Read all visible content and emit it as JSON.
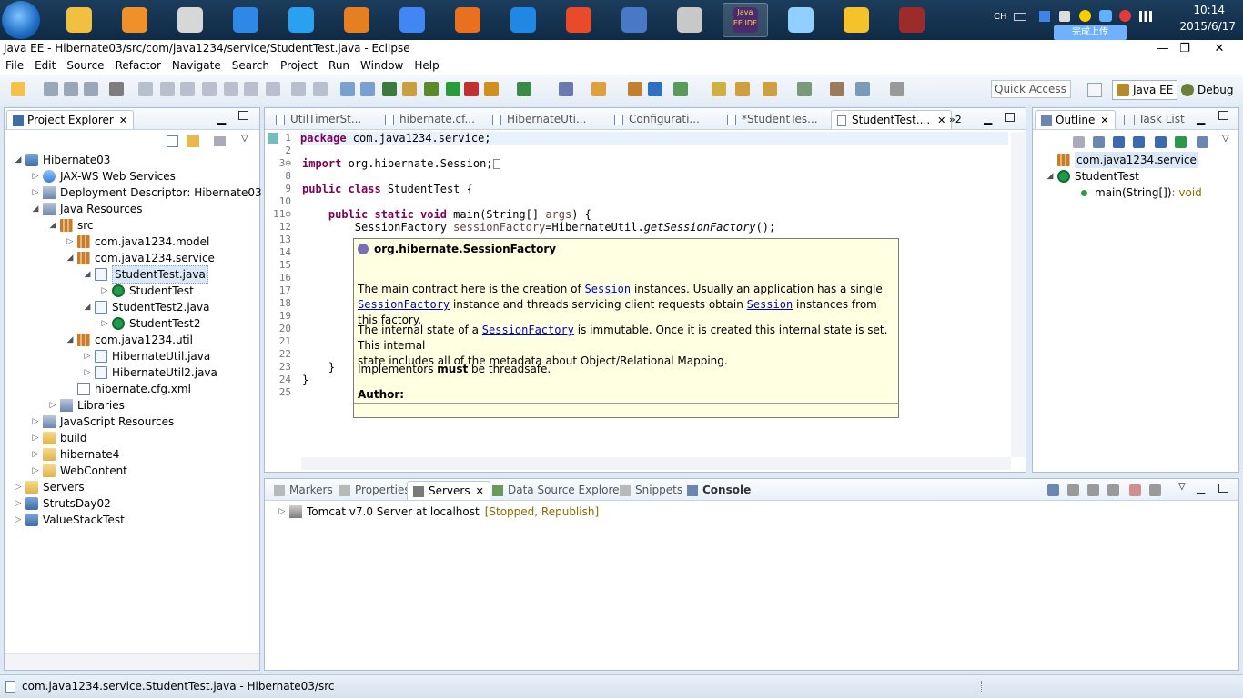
{
  "taskbar": {
    "apps": [
      "start-orb",
      "file-explorer",
      "media-player",
      "speaker-app",
      "cloud-sync",
      "baidu-app",
      "sublime-text",
      "chrome",
      "firefox",
      "internet-explorer",
      "flash-app",
      "rdp-app",
      "java-cup",
      "eclipse-java-ee",
      "paint-app",
      "heart-app",
      "database-app"
    ],
    "eclipse_label": "Java EE IDE",
    "ime_label": "CH",
    "upload_label": "完成上传",
    "time": "10:14",
    "date": "2015/6/17"
  },
  "window": {
    "title": "Java EE - Hibernate03/src/com/java1234/service/StudentTest.java - Eclipse",
    "minimize": "—",
    "maximize": "❐",
    "close": "✕"
  },
  "menu": [
    "File",
    "Edit",
    "Source",
    "Refactor",
    "Navigate",
    "Search",
    "Project",
    "Run",
    "Window",
    "Help"
  ],
  "toolbar": {
    "quick_access": "Quick Access",
    "perspectives": [
      "Java EE",
      "Debug"
    ]
  },
  "project_explorer": {
    "tab": "Project Explorer",
    "rows": [
      {
        "label": "Hibernate03",
        "indent": 0,
        "icon": "project",
        "twisty": "open"
      },
      {
        "label": "JAX-WS Web Services",
        "indent": 1,
        "icon": "web",
        "twisty": "closed"
      },
      {
        "label": "Deployment Descriptor: Hibernate03",
        "indent": 1,
        "icon": "lib",
        "twisty": "closed"
      },
      {
        "label": "Java Resources",
        "indent": 1,
        "icon": "lib",
        "twisty": "open"
      },
      {
        "label": "src",
        "indent": 2,
        "icon": "pkg",
        "twisty": "open"
      },
      {
        "label": "com.java1234.model",
        "indent": 3,
        "icon": "pkg",
        "twisty": "closed"
      },
      {
        "label": "com.java1234.service",
        "indent": 3,
        "icon": "pkg",
        "twisty": "open"
      },
      {
        "label": "StudentTest.java",
        "indent": 4,
        "icon": "java",
        "twisty": "open",
        "selected": true
      },
      {
        "label": "StudentTest",
        "indent": 5,
        "icon": "class",
        "twisty": "closed"
      },
      {
        "label": "StudentTest2.java",
        "indent": 4,
        "icon": "java",
        "twisty": "open"
      },
      {
        "label": "StudentTest2",
        "indent": 5,
        "icon": "class",
        "twisty": "closed"
      },
      {
        "label": "com.java1234.util",
        "indent": 3,
        "icon": "pkg",
        "twisty": "open"
      },
      {
        "label": "HibernateUtil.java",
        "indent": 4,
        "icon": "java",
        "twisty": "closed"
      },
      {
        "label": "HibernateUtil2.java",
        "indent": 4,
        "icon": "java",
        "twisty": "closed"
      },
      {
        "label": "hibernate.cfg.xml",
        "indent": 3,
        "icon": "xml",
        "twisty": "none"
      },
      {
        "label": "Libraries",
        "indent": 2,
        "icon": "lib",
        "twisty": "closed"
      },
      {
        "label": "JavaScript Resources",
        "indent": 1,
        "icon": "lib",
        "twisty": "closed"
      },
      {
        "label": "build",
        "indent": 1,
        "icon": "folder",
        "twisty": "closed"
      },
      {
        "label": "hibernate4",
        "indent": 1,
        "icon": "folder",
        "twisty": "closed"
      },
      {
        "label": "WebContent",
        "indent": 1,
        "icon": "folder",
        "twisty": "closed"
      },
      {
        "label": "Servers",
        "indent": 0,
        "icon": "folder",
        "twisty": "closed"
      },
      {
        "label": "StrutsDay02",
        "indent": 0,
        "icon": "project",
        "twisty": "closed"
      },
      {
        "label": "ValueStackTest",
        "indent": 0,
        "icon": "project",
        "twisty": "closed"
      }
    ]
  },
  "editor": {
    "tabs": [
      "UtilTimerSt...",
      "hibernate.cf...",
      "HibernateUti...",
      "Configurati...",
      "*StudentTes...",
      "StudentTest...."
    ],
    "overflow_label": "»2",
    "lines": [
      {
        "n": "1",
        "html": "<span class=\"kw\">package</span> com.java1234.service;"
      },
      {
        "n": "2",
        "html": ""
      },
      {
        "n": "3⊕",
        "html": "<span class=\"kw\">import</span> org.hibernate.Session;<span style=\"border:1px solid #888;display:inline-block;width:8px;height:11px;vertical-align:middle\"></span>"
      },
      {
        "n": "8",
        "html": ""
      },
      {
        "n": "9",
        "html": "<span class=\"kw\">public class</span> StudentTest {"
      },
      {
        "n": "10",
        "html": ""
      },
      {
        "n": "11⊖",
        "html": "    <span class=\"kw\">public static void</span> main(String[] <span style=\"color:#6a3e3e\">args</span>) {"
      },
      {
        "n": "12",
        "html": "        SessionFactory <span style=\"color:#6a3e3e\">sessionFactory</span>=HibernateUtil.<span class=\"it\">getSessionFactory</span>();"
      },
      {
        "n": "13",
        "html": ""
      },
      {
        "n": "14",
        "html": ""
      },
      {
        "n": "15",
        "html": ""
      },
      {
        "n": "16",
        "html": ""
      },
      {
        "n": "17",
        "html": ""
      },
      {
        "n": "18",
        "html": ""
      },
      {
        "n": "19",
        "html": ""
      },
      {
        "n": "20",
        "html": ""
      },
      {
        "n": "21",
        "html": ""
      },
      {
        "n": "22",
        "html": ""
      },
      {
        "n": "23",
        "html": "    }"
      },
      {
        "n": "24",
        "html": "}"
      },
      {
        "n": "25",
        "html": ""
      }
    ],
    "hover": {
      "title": "org.hibernate.SessionFactory",
      "p1a": "The main contract here is the creation of ",
      "p1link": "Session",
      "p1b": " instances. Usually an application has a single",
      "p1c_link": "SessionFactory",
      "p1d": " instance and threads servicing client requests obtain ",
      "p1e_link": "Session",
      "p1f": " instances from this factory.",
      "p2a": "The internal state of a ",
      "p2link": "SessionFactory",
      "p2b": " is immutable. Once it is created this internal state is set. This internal",
      "p2c": "state includes all of the metadata about Object/Relational Mapping.",
      "p3a": "Implementors ",
      "p3b": "must",
      "p3c": " be threadsafe.",
      "author": "Author:"
    }
  },
  "outline": {
    "tabs": [
      "Outline",
      "Task List"
    ],
    "rows": [
      {
        "label": "com.java1234.service",
        "indent": 0,
        "icon": "pkg"
      },
      {
        "label": "StudentTest",
        "indent": 0,
        "icon": "class"
      },
      {
        "label": "main(String[])",
        "suffix": " : void",
        "indent": 1,
        "icon": "method"
      }
    ]
  },
  "bottom": {
    "tabs": [
      "Markers",
      "Properties",
      "Servers",
      "Data Source Explorer",
      "Snippets",
      "Console"
    ],
    "server": "Tomcat v7.0 Server at localhost",
    "server_status": "[Stopped, Republish]"
  },
  "status": {
    "text": "com.java1234.service.StudentTest.java - Hibernate03/src"
  }
}
